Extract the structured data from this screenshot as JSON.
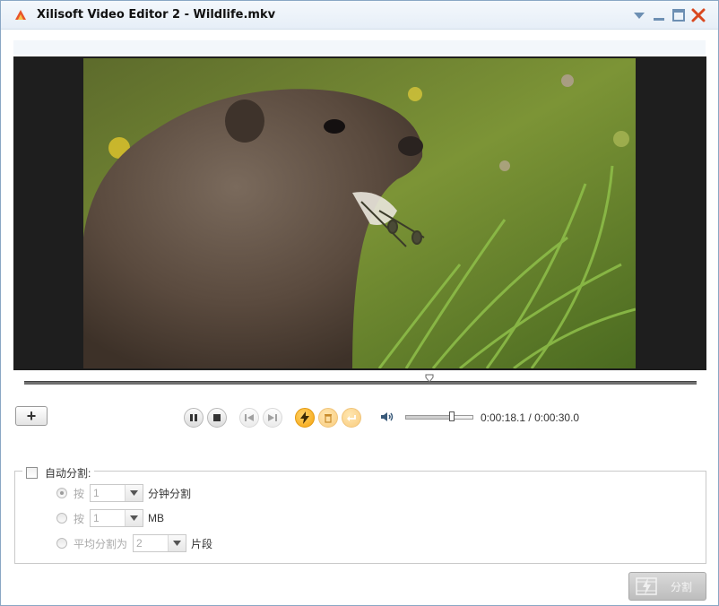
{
  "window": {
    "title": "Xilisoft Video Editor 2 - Wildlife.mkv"
  },
  "player": {
    "current_time": "0:00:18.1",
    "separator": " / ",
    "total_time": "0:00:30.0",
    "volume_fraction": 0.68,
    "position_fraction": 0.603
  },
  "split_settings": {
    "auto_split_label": "自动分割:",
    "auto_split_checked": false,
    "options": [
      {
        "prefix": "按",
        "value": "1",
        "suffix": "分钟分割",
        "selected": true
      },
      {
        "prefix": "按",
        "value": "1",
        "suffix": "MB",
        "selected": false
      },
      {
        "prefix": "平均分割为",
        "value": "2",
        "suffix": "片段",
        "selected": false
      }
    ]
  },
  "buttons": {
    "add_label": "+",
    "split_label": "分割"
  },
  "icons": {
    "app": "app-logo-icon",
    "pause": "pause-icon",
    "stop": "stop-icon",
    "prev": "prev-frame-icon",
    "next": "next-frame-icon",
    "split_marker": "lightning-icon",
    "delete": "trash-icon",
    "undo": "undo-icon",
    "volume": "volume-icon"
  },
  "colors": {
    "accent_orange": "#f5a20b",
    "close_red": "#d9481f"
  }
}
